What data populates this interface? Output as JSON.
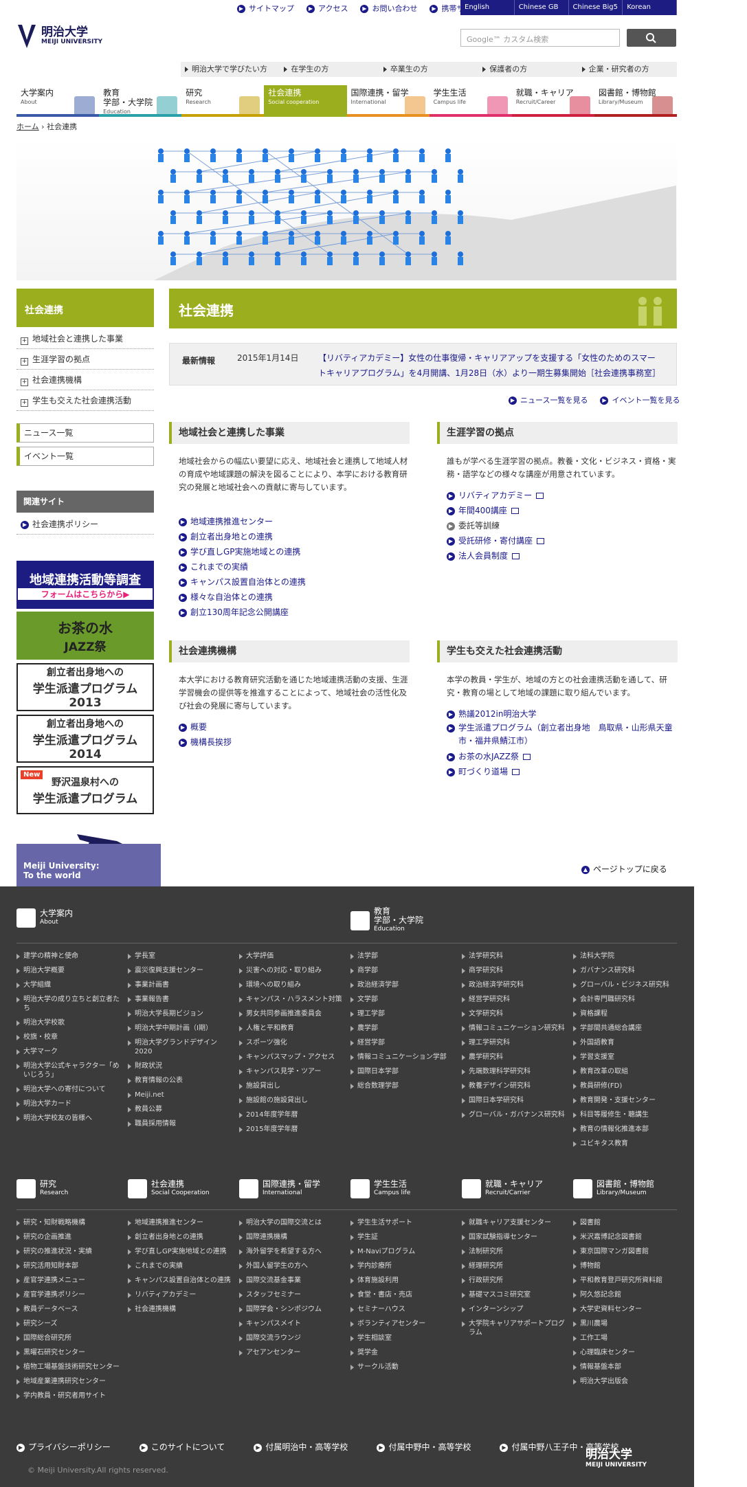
{
  "utility": [
    "サイトマップ",
    "アクセス",
    "お問い合わせ",
    "携帯サイト"
  ],
  "languages": [
    "English",
    "Chinese GB",
    "Chinese Big5",
    "Korean"
  ],
  "logo": {
    "name": "明治大学",
    "en": "MEIJI UNIVERSITY"
  },
  "search": {
    "placeholder": "Google™ カスタム検索"
  },
  "targets": [
    "明治大学で学びたい方",
    "在学生の方",
    "卒業生の方",
    "保護者の方",
    "企業・研究者の方"
  ],
  "gnav": [
    {
      "jp": "大学案内",
      "en": "About"
    },
    {
      "jp": "教育\n学部・大学院",
      "en": "Education"
    },
    {
      "jp": "研究",
      "en": "Research"
    },
    {
      "jp": "社会連携",
      "en": "Social cooperation"
    },
    {
      "jp": "国際連携・留学",
      "en": "International"
    },
    {
      "jp": "学生生活",
      "en": "Campus life"
    },
    {
      "jp": "就職・キャリア",
      "en": "Recruit/Career"
    },
    {
      "jp": "図書館・博物館",
      "en": "Library/Museum"
    }
  ],
  "breadcrumb": {
    "home": "ホーム",
    "sep": "›",
    "current": "社会連携"
  },
  "left": {
    "title": "社会連携",
    "items": [
      "地域社会と連携した事業",
      "生涯学習の拠点",
      "社会連携機構",
      "学生も交えた社会連携活動"
    ],
    "boxes": [
      "ニュース一覧",
      "イベント一覧"
    ],
    "related_title": "関連サイト",
    "related": [
      "社会連携ポリシー"
    ],
    "banners": [
      {
        "l1": "地域連携活動等調査",
        "l2": "フォームはこちらから▶"
      },
      {
        "l1": "お茶の水",
        "l2": "JAZZ祭"
      },
      {
        "l1": "創立者出身地への",
        "l2": "学生派遣プログラム",
        "l3": "2013"
      },
      {
        "l1": "創立者出身地への",
        "l2": "学生派遣プログラム",
        "l3": "2014"
      },
      {
        "new": "New",
        "l1": "野沢温泉村への",
        "l2": "学生派遣プログラム"
      }
    ]
  },
  "main": {
    "title": "社会連携",
    "news": {
      "label": "最新情報",
      "date": "2015年1月14日",
      "body": "【リバティアカデミー】女性の仕事復帰・キャリアアップを支援する「女性のためのスマートキャリアプログラム」を4月開講、1月28日（水）より一期生募集開始［社会連携事務室］"
    },
    "newslinks": [
      "ニュース一覧を見る",
      "イベント一覧を見る"
    ],
    "sections": [
      {
        "title": "地域社会と連携した事業",
        "body": "地域社会からの幅広い要望に応え、地域社会と連携して地域人材の育成や地域課題の解決を図ることにより、本学における教育研究の発展と地域社会への貢献に寄与しています。",
        "links": [
          "地域連携推進センター",
          "創立者出身地との連携",
          "学び直しGP実施地域との連携",
          "これまでの実績",
          "キャンパス設置自治体との連携",
          "様々な自治体との連携",
          "創立130周年記念公開講座"
        ]
      },
      {
        "title": "生涯学習の拠点",
        "body": "誰もが学べる生涯学習の拠点。教養・文化・ビジネス・資格・実務・語学などの様々な講座が用意されています。",
        "links": [
          "リバティアカデミー",
          "年間400講座",
          "委託等訓練",
          "受託研修・寄付講座",
          "法人会員制度"
        ]
      },
      {
        "title": "社会連携機構",
        "body": "本大学における教育研究活動を通じた地域連携活動の支援、生涯学習機会の提供等を推進することによって、地域社会の活性化及び社会の発展に寄与しています。",
        "links": [
          "概要",
          "機構長挨拶"
        ]
      },
      {
        "title": "学生も交えた社会連携活動",
        "body": "本学の教員・学生が、地域の方との社会連携活動を通して、研究・教育の場として地域の課題に取り組んでいます。",
        "links": [
          "熟議2012in明治大学",
          "学生派遣プログラム（創立者出身地　鳥取県・山形県天童市・福井県鯖江市）",
          "お茶の水JAZZ祭",
          "町づくり道場"
        ]
      }
    ]
  },
  "pagetop": "ページトップに戻る",
  "tagline": "Meiji University:\nTo the world",
  "footer": {
    "cat1": [
      {
        "jp": "大学案内",
        "en": "About"
      },
      {
        "jp": "教育\n学部・大学院",
        "en": "Education"
      }
    ],
    "cols1": [
      [
        "建学の精神と使命",
        "明治大学概要",
        "大学組織",
        "明治大学の成り立ちと創立者たち",
        "明治大学校歌",
        "校旗・校章",
        "大学マーク",
        "明治大学公式キャラクター「めいじろう」",
        "明治大学への寄付について",
        "明治大学カード",
        "明治大学校友の皆様へ"
      ],
      [
        "学長室",
        "震災復興支援センター",
        "事業計画書",
        "事業報告書",
        "明治大学長期ビジョン",
        "明治大学中期計画（Ⅰ期）",
        "明治大学グランドデザイン2020",
        "財政状況",
        "教育情報の公表",
        "Meiji.net",
        "教員公募",
        "職員採用情報"
      ],
      [
        "大学評価",
        "災害への対応・取り組み",
        "環境への取り組み",
        "キャンパス・ハラスメント対策",
        "男女共同参画推進委員会",
        "人権と平和教育",
        "スポーツ強化",
        "キャンパスマップ・アクセス",
        "キャンパス見学・ツアー",
        "施設貸出し",
        "施設館の施設貸出し",
        "2014年度学年暦",
        "2015年度学年暦"
      ],
      [
        "法学部",
        "商学部",
        "政治経済学部",
        "文学部",
        "理工学部",
        "農学部",
        "経営学部",
        "情報コミュニケーション学部",
        "国際日本学部",
        "総合数理学部"
      ],
      [
        "法学研究科",
        "商学研究科",
        "政治経済学研究科",
        "経営学研究科",
        "文学研究科",
        "情報コミュニケーション研究科",
        "理工学研究科",
        "農学研究科",
        "先端数理科学研究科",
        "教養デザイン研究科",
        "国際日本学研究科",
        "グローバル・ガバナンス研究科"
      ],
      [
        "法科大学院",
        "ガバナンス研究科",
        "グローバル・ビジネス研究科",
        "会計専門職研究科",
        "資格課程",
        "学部間共通総合講座",
        "外国語教育",
        "学習支援室",
        "教育改革の取組",
        "教員研修(FD)",
        "教育開発・支援センター",
        "科目等履修生・聴講生",
        "教育の情報化推進本部",
        "ユビキタス教育"
      ]
    ],
    "cat2": [
      {
        "jp": "研究",
        "en": "Research"
      },
      {
        "jp": "社会連携",
        "en": "Social Cooperation"
      },
      {
        "jp": "国際連携・留学",
        "en": "International"
      },
      {
        "jp": "学生生活",
        "en": "Campus life"
      },
      {
        "jp": "就職・キャリア",
        "en": "Recruit/Carrier"
      },
      {
        "jp": "図書館・博物館",
        "en": "Library/Museum"
      }
    ],
    "cols2": [
      [
        "研究・知財戦略機構",
        "研究の企画推進",
        "研究の推進状況・実績",
        "研究活用知財本部",
        "産官学連携メニュー",
        "産官学連携ポリシー",
        "教員データベース",
        "研究シーズ",
        "国際総合研究所",
        "黒曜石研究センター",
        "植物工場基盤技術研究センター",
        "地域産業連携研究センター",
        "学内教員・研究者用サイト"
      ],
      [
        "地域連携推進センター",
        "創立者出身地との連携",
        "学び直しGP実施地域との連携",
        "これまでの実績",
        "キャンパス設置自治体との連携",
        "リバティアカデミー",
        "社会連携機構"
      ],
      [
        "明治大学の国際交流とは",
        "国際連携機構",
        "海外留学を希望する方へ",
        "外国人留学生の方へ",
        "国際交流基金事業",
        "スタッフセミナー",
        "国際学会・シンポジウム",
        "キャンパスメイト",
        "国際交流ラウンジ",
        "アセアンセンター"
      ],
      [
        "学生生活サポート",
        "学生証",
        "M-Naviプログラム",
        "学内診療所",
        "体育施設利用",
        "食堂・書店・売店",
        "セミナーハウス",
        "ボランティアセンター",
        "学生相談室",
        "奨学金",
        "サークル活動"
      ],
      [
        "就職キャリア支援センター",
        "国家試験指導センター",
        "法制研究所",
        "経理研究所",
        "行政研究所",
        "基礎マスコミ研究室",
        "インターンシップ",
        "大学院キャリアサポートプログラム"
      ],
      [
        "図書館",
        "米沢嘉博記念図書館",
        "東京国際マンガ図書館",
        "博物館",
        "平和教育登戸研究所資料館",
        "阿久悠記念館",
        "大学史資料センター",
        "黒川農場",
        "工作工場",
        "心理臨床センター",
        "情報基盤本部",
        "明治大学出版会"
      ]
    ],
    "bottom": [
      "プライバシーポリシー",
      "このサイトについて",
      "付属明治中・高等学校",
      "付属中野中・高等学校",
      "付属中野八王子中・高等学校"
    ],
    "copyright": "© Meiji University.All rights reserved.",
    "logo": {
      "name": "明治大学",
      "en": "MEIJI UNIVERSITY"
    }
  }
}
